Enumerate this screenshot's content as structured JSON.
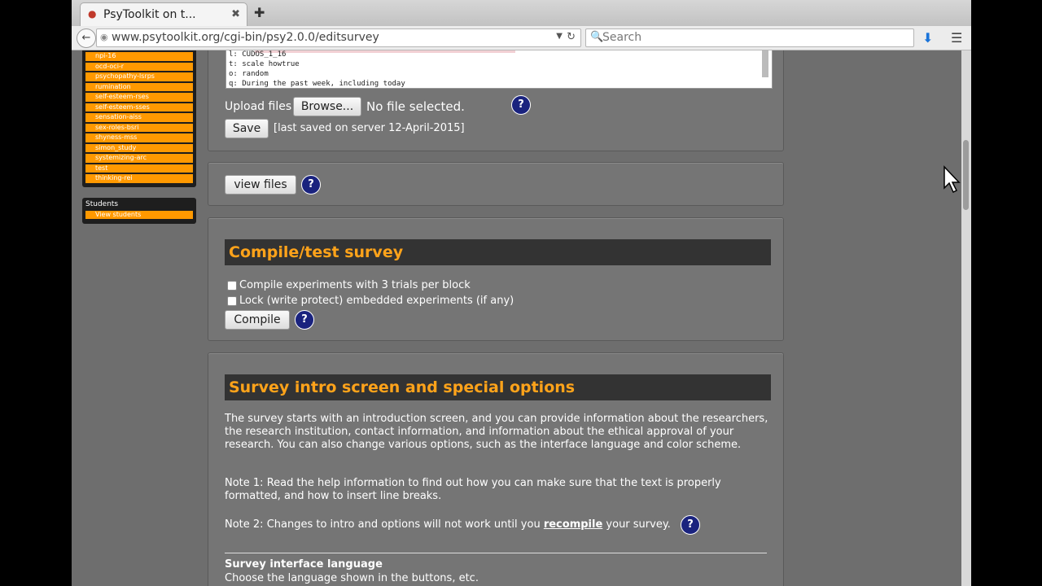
{
  "browser": {
    "tab_title": "PsyToolkit on t...",
    "tab_close": "✖",
    "new_tab": "✚",
    "url": "www.psytoolkit.org/cgi-bin/psy2.0.0/editsurvey",
    "search_placeholder": "Search"
  },
  "sidebar": {
    "items": [
      "npi-16",
      "ocd-oci-r",
      "psychopathy-lsrps",
      "rumination",
      "self-esteem-rses",
      "self-esteem-sses",
      "sensation-aiss",
      "sex-roles-bsri",
      "shyness-mss",
      "simon_study",
      "systemizing-arc",
      "test",
      "thinking-rei"
    ],
    "students_header": "Students",
    "students_items": [
      "View students"
    ]
  },
  "editor": {
    "lines": [
      "l: CUDOS_1_16",
      "t: scale howtrue",
      "o: random",
      "q: During the past week, including today"
    ],
    "upload_label": "Upload files",
    "browse_label": "Browse...",
    "no_file": "No file selected.",
    "save_label": "Save",
    "saved_status": "[last saved on server 12-April-2015]"
  },
  "files": {
    "view_files_label": "view files"
  },
  "compile": {
    "title": "Compile/test survey",
    "option1": "Compile experiments with 3 trials per block",
    "option2": "Lock (write protect) embedded experiments (if any)",
    "compile_label": "Compile"
  },
  "intro": {
    "title": "Survey intro screen and special options",
    "para1": "The survey starts with an introduction screen, and you can provide information about the researchers, the research institution, contact information, and information about the ethical approval of your research. You can also change various options, such as the interface language and color scheme.",
    "para2": "Note 1: Read the help information to find out how you can make sure that the text is properly formatted, and how to insert line breaks.",
    "note2_prefix": "Note 2: Changes to intro and options will not work until you",
    "note2_link": "recompile",
    "note2_suffix": "your survey.",
    "lang_heading": "Survey interface language",
    "lang_desc": "Choose the language shown in the buttons, etc."
  },
  "help_symbol": "?"
}
